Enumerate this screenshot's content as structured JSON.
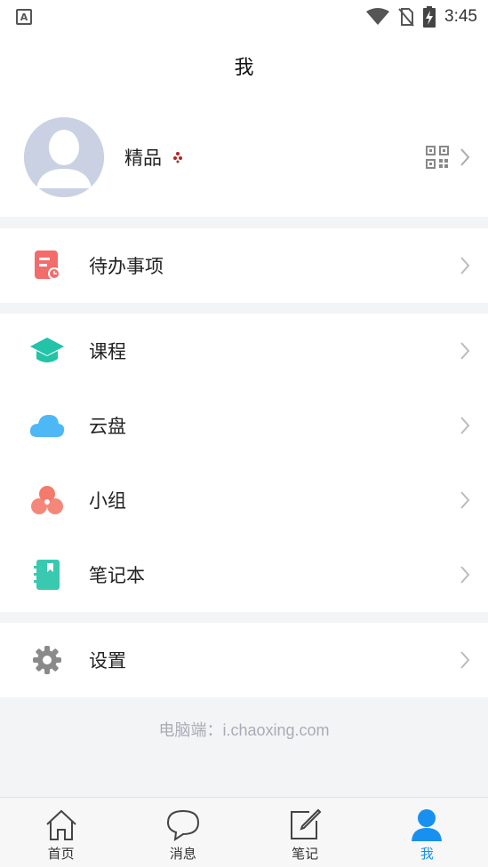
{
  "status_bar": {
    "time": "3:45",
    "icons": [
      "a-notification-icon",
      "wifi-icon",
      "no-sim-icon",
      "battery-charging-icon"
    ]
  },
  "header": {
    "title": "我"
  },
  "profile": {
    "name": "精品",
    "badge_icon": "sparkle-icon",
    "qr_icon": "qr-code-icon"
  },
  "menu_groups": [
    {
      "items": [
        {
          "label": "待办事项",
          "icon": "todo-icon",
          "color": "#f46b6b"
        }
      ]
    },
    {
      "items": [
        {
          "label": "课程",
          "icon": "course-icon",
          "color": "#22c3a6"
        },
        {
          "label": "云盘",
          "icon": "cloud-icon",
          "color": "#4db8f5"
        },
        {
          "label": "小组",
          "icon": "group-icon",
          "color": "#f47a6b"
        },
        {
          "label": "笔记本",
          "icon": "notebook-icon",
          "color": "#39c9b1"
        }
      ]
    },
    {
      "items": [
        {
          "label": "设置",
          "icon": "settings-icon",
          "color": "#888888"
        }
      ]
    }
  ],
  "footer": {
    "text": "电脑端：i.chaoxing.com"
  },
  "tab_bar": {
    "active_color": "#1890f0",
    "tabs": [
      {
        "label": "首页",
        "icon": "home-icon",
        "active": false
      },
      {
        "label": "消息",
        "icon": "message-icon",
        "active": false
      },
      {
        "label": "笔记",
        "icon": "note-icon",
        "active": false
      },
      {
        "label": "我",
        "icon": "person-icon",
        "active": true
      }
    ]
  }
}
